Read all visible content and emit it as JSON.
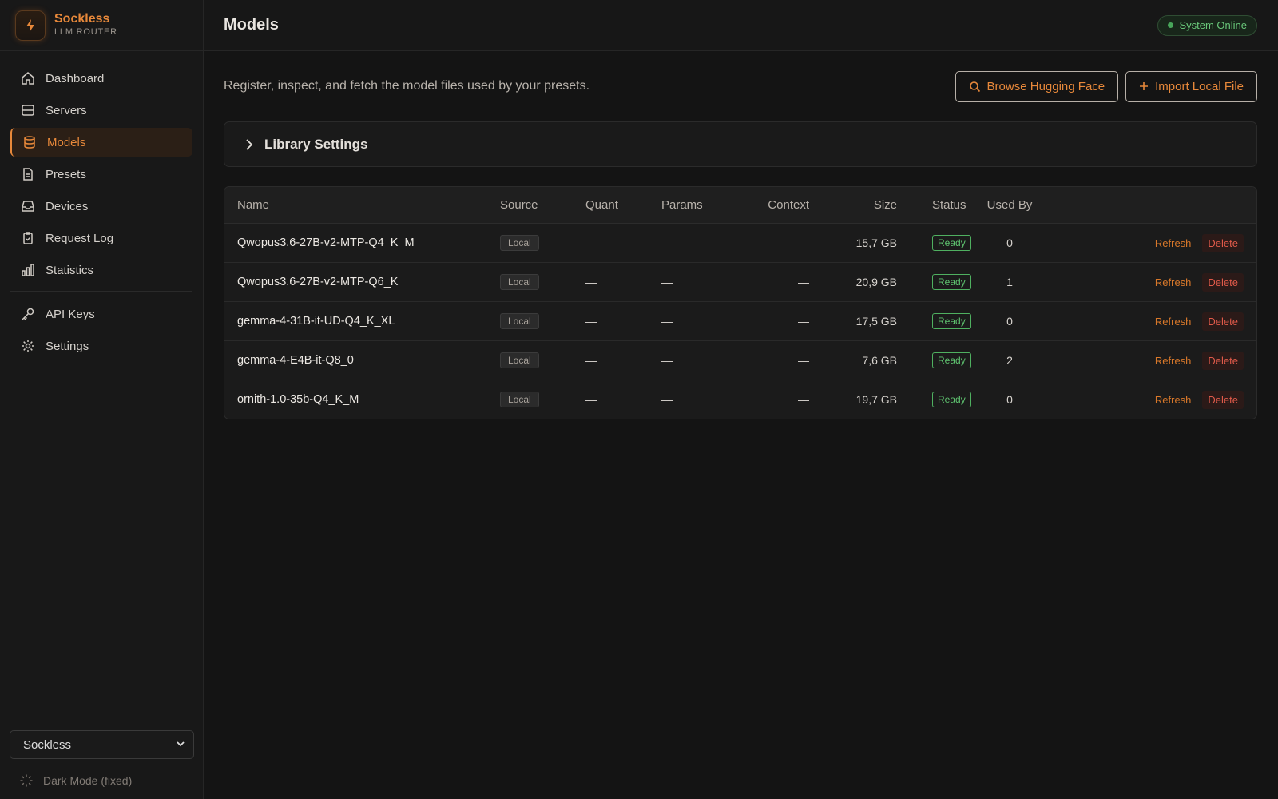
{
  "brand": {
    "name": "Sockless",
    "subtitle": "LLM ROUTER"
  },
  "nav": {
    "main_items": [
      {
        "label": "Dashboard",
        "icon": "home-icon"
      },
      {
        "label": "Servers",
        "icon": "server-icon"
      },
      {
        "label": "Models",
        "icon": "database-icon",
        "active": true
      },
      {
        "label": "Presets",
        "icon": "document-icon"
      },
      {
        "label": "Devices",
        "icon": "inbox-icon"
      },
      {
        "label": "Request Log",
        "icon": "clipboard-icon"
      },
      {
        "label": "Statistics",
        "icon": "bar-chart-icon"
      }
    ],
    "secondary_items": [
      {
        "label": "API Keys",
        "icon": "key-icon"
      },
      {
        "label": "Settings",
        "icon": "gear-icon"
      }
    ]
  },
  "sidebar_bottom": {
    "selected_user": "Sockless",
    "mode_label": "Dark Mode (fixed)"
  },
  "header": {
    "title": "Models",
    "status": "System Online"
  },
  "main": {
    "intro": "Register, inspect, and fetch the model files used by your presets.",
    "browse_button": "Browse Hugging Face",
    "import_button": "Import Local File",
    "library_settings": "Library Settings"
  },
  "table": {
    "columns": {
      "name": "Name",
      "source": "Source",
      "quant": "Quant",
      "params": "Params",
      "context": "Context",
      "size": "Size",
      "status": "Status",
      "used_by": "Used By"
    },
    "rows": [
      {
        "name": "Qwopus3.6-27B-v2-MTP-Q4_K_M",
        "source": "Local",
        "quant": "—",
        "params": "—",
        "context": "—",
        "size": "15,7 GB",
        "status": "Ready",
        "used_by": "0",
        "refresh": "Refresh",
        "delete": "Delete"
      },
      {
        "name": "Qwopus3.6-27B-v2-MTP-Q6_K",
        "source": "Local",
        "quant": "—",
        "params": "—",
        "context": "—",
        "size": "20,9 GB",
        "status": "Ready",
        "used_by": "1",
        "refresh": "Refresh",
        "delete": "Delete"
      },
      {
        "name": "gemma-4-31B-it-UD-Q4_K_XL",
        "source": "Local",
        "quant": "—",
        "params": "—",
        "context": "—",
        "size": "17,5 GB",
        "status": "Ready",
        "used_by": "0",
        "refresh": "Refresh",
        "delete": "Delete"
      },
      {
        "name": "gemma-4-E4B-it-Q8_0",
        "source": "Local",
        "quant": "—",
        "params": "—",
        "context": "—",
        "size": "7,6 GB",
        "status": "Ready",
        "used_by": "2",
        "refresh": "Refresh",
        "delete": "Delete"
      },
      {
        "name": "ornith-1.0-35b-Q4_K_M",
        "source": "Local",
        "quant": "—",
        "params": "—",
        "context": "—",
        "size": "19,7 GB",
        "status": "Ready",
        "used_by": "0",
        "refresh": "Refresh",
        "delete": "Delete"
      }
    ]
  },
  "colors": {
    "accent": "#e7883a",
    "success": "#5fc470",
    "danger": "#e05a4a",
    "background": "#141414"
  }
}
